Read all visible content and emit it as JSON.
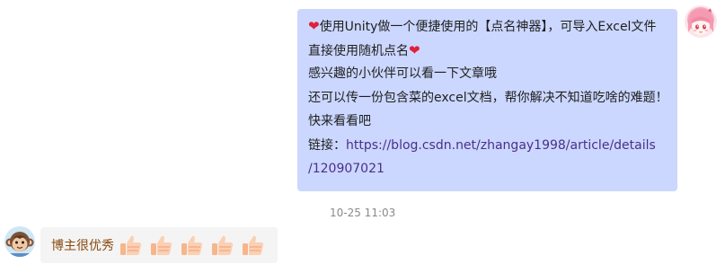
{
  "outgoing_message": {
    "line1_text": "使用Unity做一个便捷使用的【点名神器】，可导入Excel文件",
    "line2_text": "直接使用随机点名",
    "line3_text": "感兴趣的小伙伴可以看一下文章哦",
    "line4_text": "还可以传一份包含菜的excel文档，帮你解决不知道吃啥的难题！",
    "line5_text": "快来看看吧",
    "link_label": "链接：",
    "link_url_part1": "https://blog.csdn.net/zhangay1998/article/details",
    "link_url_part2": "/120907021",
    "heart_glyph": "❤",
    "bubble_color": "#cbd7fe"
  },
  "timestamp": "10-25 11:03",
  "incoming_message": {
    "text": "博主很优秀",
    "emoji_name": "thumbs-up",
    "emoji_count": 5,
    "bubble_color": "#f4f4f4"
  },
  "avatars": {
    "me": "anime-girl-avatar",
    "other": "monkey-avatar"
  }
}
